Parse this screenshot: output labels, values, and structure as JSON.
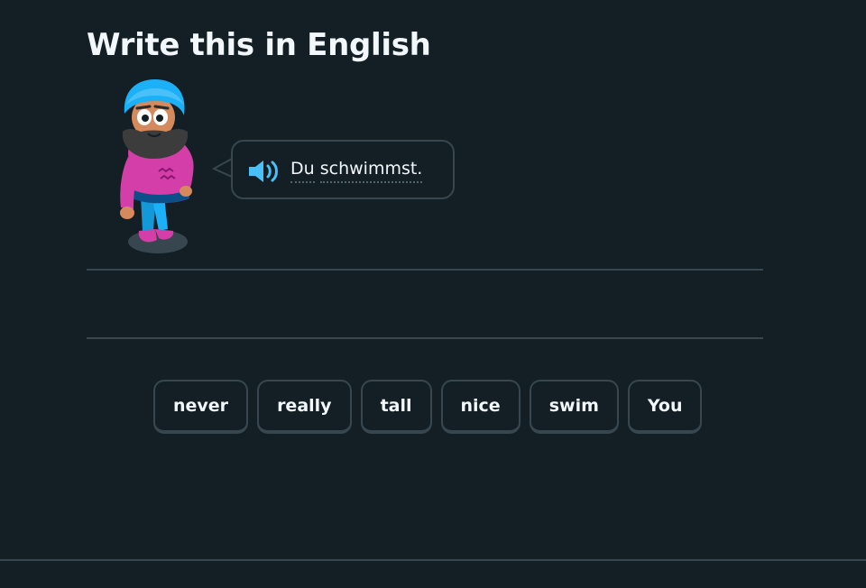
{
  "header": {
    "title": "Write this in English"
  },
  "prompt": {
    "words": [
      "Du",
      "schwimmst."
    ]
  },
  "word_bank": {
    "tiles": [
      "never",
      "really",
      "tall",
      "nice",
      "swim",
      "You"
    ]
  },
  "colors": {
    "background": "#131f24",
    "border": "#37464f",
    "text": "#f1f7fb",
    "speaker": "#49c0f8",
    "turban": "#1cb0f6",
    "sweater": "#d33ea8"
  },
  "icons": {
    "speaker": "speaker-icon",
    "character": "character-illustration"
  }
}
